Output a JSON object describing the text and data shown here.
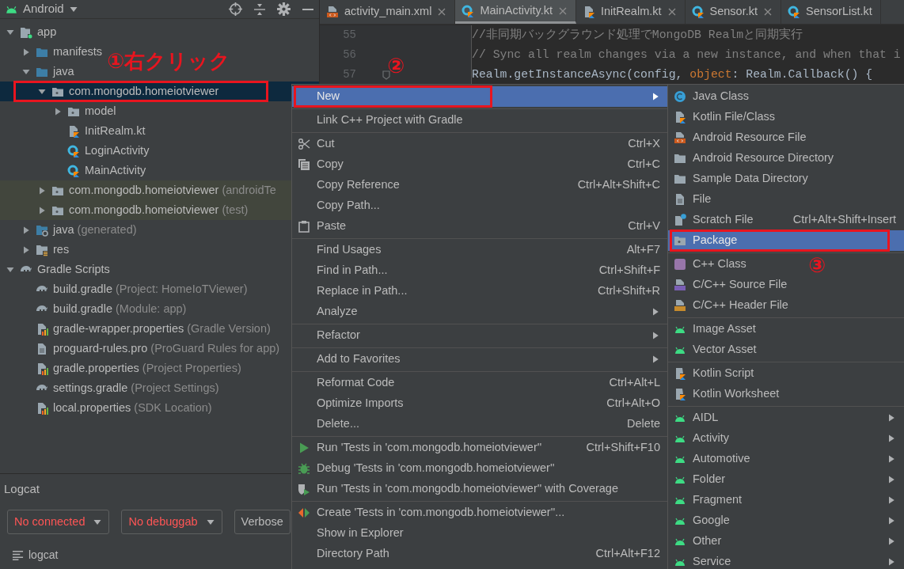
{
  "project_panel": {
    "title": "Android",
    "tree": [
      {
        "label": "app",
        "kind": "module",
        "expanded": true,
        "selected": false,
        "children": [
          {
            "label": "manifests",
            "kind": "folder",
            "expanded": false,
            "selected": false
          },
          {
            "label": "java",
            "kind": "folder",
            "expanded": true,
            "selected": false,
            "children": [
              {
                "label": "com.mongodb.homeiotviewer",
                "kind": "package",
                "expanded": true,
                "selected": true,
                "outlined": true,
                "callout": "①右クリック",
                "children": [
                  {
                    "label": "model",
                    "kind": "package",
                    "expanded": false,
                    "selected": false
                  },
                  {
                    "label": "InitRealm.kt",
                    "kind": "kotlin-file",
                    "selected": false
                  },
                  {
                    "label": "LoginActivity",
                    "kind": "kotlin-class",
                    "selected": false
                  },
                  {
                    "label": "MainActivity",
                    "kind": "kotlin-class",
                    "selected": false
                  }
                ]
              },
              {
                "label": "com.mongodb.homeiotviewer",
                "note": "(androidTe",
                "kind": "package",
                "expanded": false,
                "selected": false,
                "tinted": true
              },
              {
                "label": "com.mongodb.homeiotviewer",
                "note": "(test)",
                "kind": "package",
                "expanded": false,
                "selected": false,
                "tinted": true
              }
            ]
          },
          {
            "label": "java",
            "note": "(generated)",
            "kind": "generated",
            "expanded": false,
            "selected": false
          },
          {
            "label": "res",
            "kind": "res",
            "expanded": false,
            "selected": false
          }
        ]
      },
      {
        "label": "Gradle Scripts",
        "kind": "gradle",
        "expanded": true,
        "selected": false,
        "children": [
          {
            "label": "build.gradle",
            "note": "(Project: HomeIoTViewer)",
            "kind": "gradle",
            "selected": false
          },
          {
            "label": "build.gradle",
            "note": "(Module: app)",
            "kind": "gradle",
            "selected": false
          },
          {
            "label": "gradle-wrapper.properties",
            "note": "(Gradle Version)",
            "kind": "properties",
            "selected": false
          },
          {
            "label": "proguard-rules.pro",
            "note": "(ProGuard Rules for app)",
            "kind": "text-file",
            "selected": false
          },
          {
            "label": "gradle.properties",
            "note": "(Project Properties)",
            "kind": "properties",
            "selected": false
          },
          {
            "label": "settings.gradle",
            "note": "(Project Settings)",
            "kind": "gradle",
            "selected": false
          },
          {
            "label": "local.properties",
            "note": "(SDK Location)",
            "kind": "properties",
            "selected": false
          }
        ]
      }
    ]
  },
  "logcat": {
    "title": "Logcat",
    "dropdowns": [
      {
        "value": "No connected",
        "error": true
      },
      {
        "value": "No debuggab",
        "error": true
      },
      {
        "value": "Verbose",
        "error": false
      }
    ],
    "tab": "logcat"
  },
  "editor": {
    "tabs": [
      {
        "label": "activity_main.xml",
        "kind": "xml-res",
        "selected": false,
        "closable": true
      },
      {
        "label": "MainActivity.kt",
        "kind": "kotlin-class",
        "selected": true,
        "closable": true
      },
      {
        "label": "InitRealm.kt",
        "kind": "kotlin-file",
        "selected": false,
        "closable": true
      },
      {
        "label": "Sensor.kt",
        "kind": "kotlin-class",
        "selected": false,
        "closable": true
      },
      {
        "label": "SensorList.kt",
        "kind": "kotlin-class",
        "selected": false,
        "closable": false
      }
    ],
    "lines": [
      {
        "number": "55",
        "fold_marker": false,
        "segments": [
          {
            "text": "//非同期バックグラウンド処理でMongoDB Realmと同期実行",
            "kind": "comment"
          }
        ]
      },
      {
        "number": "56",
        "fold_marker": false,
        "segments": [
          {
            "text": "// Sync all realm changes via a new instance, and when that i",
            "kind": "comment"
          }
        ]
      },
      {
        "number": "57",
        "fold_marker": true,
        "segments": [
          {
            "text": "Realm.getInstanceAsync(config, ",
            "kind": "plain"
          },
          {
            "text": "object",
            "kind": "keyword"
          },
          {
            "text": ": Realm.Callback() {",
            "kind": "plain"
          }
        ]
      }
    ]
  },
  "context_menu": {
    "groups": [
      [
        {
          "label": "New",
          "submenu": true,
          "selected": true,
          "outlined": true,
          "callout": "②"
        }
      ],
      [
        {
          "label": "Link C++ Project with Gradle",
          "submenu": false,
          "selected": false
        }
      ],
      [
        {
          "label": "Cut",
          "shortcut": "Ctrl+X",
          "kind": "scissors",
          "submenu": false,
          "selected": false
        },
        {
          "label": "Copy",
          "shortcut": "Ctrl+C",
          "kind": "copy",
          "submenu": false,
          "selected": false
        },
        {
          "label": "Copy Reference",
          "shortcut": "Ctrl+Alt+Shift+C",
          "submenu": false,
          "selected": false
        },
        {
          "label": "Copy Path...",
          "submenu": false,
          "selected": false
        },
        {
          "label": "Paste",
          "shortcut": "Ctrl+V",
          "kind": "paste",
          "submenu": false,
          "selected": false
        }
      ],
      [
        {
          "label": "Find Usages",
          "shortcut": "Alt+F7",
          "submenu": false,
          "selected": false
        },
        {
          "label": "Find in Path...",
          "shortcut": "Ctrl+Shift+F",
          "submenu": false,
          "selected": false
        },
        {
          "label": "Replace in Path...",
          "shortcut": "Ctrl+Shift+R",
          "submenu": false,
          "selected": false
        },
        {
          "label": "Analyze",
          "submenu": true,
          "selected": false
        }
      ],
      [
        {
          "label": "Refactor",
          "submenu": true,
          "selected": false
        }
      ],
      [
        {
          "label": "Add to Favorites",
          "submenu": true,
          "selected": false
        }
      ],
      [
        {
          "label": "Reformat Code",
          "shortcut": "Ctrl+Alt+L",
          "submenu": false,
          "selected": false
        },
        {
          "label": "Optimize Imports",
          "shortcut": "Ctrl+Alt+O",
          "submenu": false,
          "selected": false
        },
        {
          "label": "Delete...",
          "shortcut": "Delete",
          "submenu": false,
          "selected": false
        }
      ],
      [
        {
          "label": "Run 'Tests in 'com.mongodb.homeiotviewer''",
          "shortcut": "Ctrl+Shift+F10",
          "kind": "run",
          "submenu": false,
          "selected": false
        },
        {
          "label": "Debug 'Tests in 'com.mongodb.homeiotviewer''",
          "kind": "debug",
          "submenu": false,
          "selected": false
        },
        {
          "label": "Run 'Tests in 'com.mongodb.homeiotviewer'' with Coverage",
          "kind": "coverage",
          "submenu": false,
          "selected": false
        }
      ],
      [
        {
          "label": "Create 'Tests in 'com.mongodb.homeiotviewer''...",
          "kind": "create-test",
          "submenu": false,
          "selected": false
        },
        {
          "label": "Show in Explorer",
          "submenu": false,
          "selected": false
        },
        {
          "label": "Directory Path",
          "shortcut": "Ctrl+Alt+F12",
          "submenu": false,
          "selected": false
        }
      ]
    ]
  },
  "new_submenu": {
    "groups": [
      [
        {
          "label": "Java Class",
          "kind": "java-class",
          "submenu": false,
          "selected": false
        },
        {
          "label": "Kotlin File/Class",
          "kind": "kotlin-file",
          "submenu": false,
          "selected": false
        },
        {
          "label": "Android Resource File",
          "kind": "xml-res",
          "submenu": false,
          "selected": false
        },
        {
          "label": "Android Resource Directory",
          "kind": "plain-folder",
          "submenu": false,
          "selected": false
        },
        {
          "label": "Sample Data Directory",
          "kind": "plain-folder",
          "submenu": false,
          "selected": false
        },
        {
          "label": "File",
          "kind": "text-file",
          "submenu": false,
          "selected": false
        },
        {
          "label": "Scratch File",
          "shortcut": "Ctrl+Alt+Shift+Insert",
          "kind": "scratch",
          "submenu": false,
          "selected": false
        },
        {
          "label": "Package",
          "kind": "package",
          "submenu": false,
          "selected": true,
          "outlined": true,
          "callout": "③"
        }
      ],
      [
        {
          "label": "C++ Class",
          "kind": "cpp-class",
          "submenu": false,
          "selected": false
        },
        {
          "label": "C/C++ Source File",
          "kind": "cpp-source",
          "submenu": false,
          "selected": false
        },
        {
          "label": "C/C++ Header File",
          "kind": "cpp-header",
          "submenu": false,
          "selected": false
        }
      ],
      [
        {
          "label": "Image Asset",
          "kind": "android",
          "submenu": false,
          "selected": false
        },
        {
          "label": "Vector Asset",
          "kind": "android",
          "submenu": false,
          "selected": false
        }
      ],
      [
        {
          "label": "Kotlin Script",
          "kind": "kotlin-script",
          "submenu": false,
          "selected": false
        },
        {
          "label": "Kotlin Worksheet",
          "kind": "kotlin-script",
          "submenu": false,
          "selected": false
        }
      ],
      [
        {
          "label": "AIDL",
          "kind": "android",
          "submenu": true,
          "selected": false
        },
        {
          "label": "Activity",
          "kind": "android",
          "submenu": true,
          "selected": false
        },
        {
          "label": "Automotive",
          "kind": "android",
          "submenu": true,
          "selected": false
        },
        {
          "label": "Folder",
          "kind": "android",
          "submenu": true,
          "selected": false
        },
        {
          "label": "Fragment",
          "kind": "android",
          "submenu": true,
          "selected": false
        },
        {
          "label": "Google",
          "kind": "android",
          "submenu": true,
          "selected": false
        },
        {
          "label": "Other",
          "kind": "android",
          "submenu": true,
          "selected": false
        },
        {
          "label": "Service",
          "kind": "android",
          "submenu": true,
          "selected": false
        }
      ]
    ]
  }
}
